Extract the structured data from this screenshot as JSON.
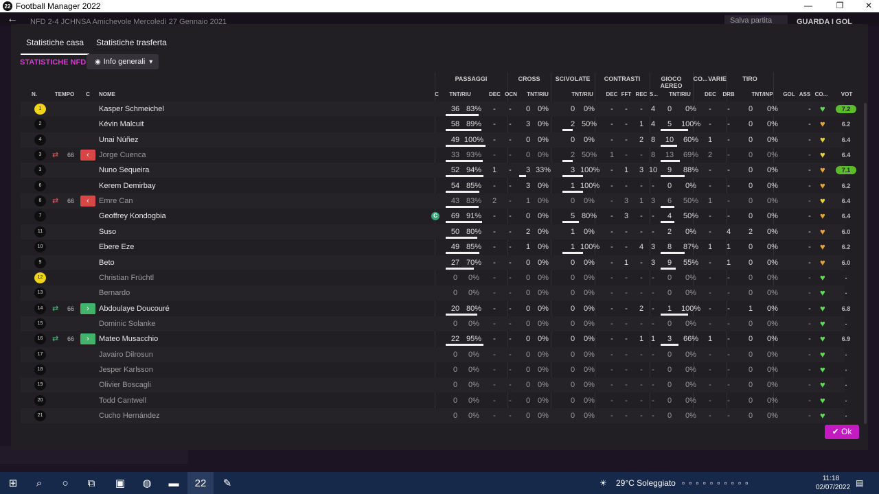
{
  "window": {
    "title": "Football Manager 2022",
    "app_icon": "22",
    "minimize": "—",
    "maximize": "❐",
    "close": "✕"
  },
  "appbar": {
    "match": "NFD 2-4 JCHNSA Amichevole Mercoledì 27 Gennaio 2021",
    "save_label": "Salva partita",
    "next_label": "GUARDA I GOL"
  },
  "tabs": [
    "Statistiche casa",
    "Statistiche trasferta"
  ],
  "section_title": "STATISTICHE NFD",
  "dropdown": "Info generali",
  "groups": {
    "passaggi": "PASSAGGI",
    "cross": "CROSS",
    "scivolate": "SCIVOLATE",
    "contrasti": "CONTRASTI",
    "gioco_aereo": "GIOCO AEREO",
    "co": "CO...",
    "varie": "VARIE",
    "tiro": "TIRO"
  },
  "headers": {
    "n": "N.",
    "tempo": "TEMPO",
    "c": "C",
    "nome": "NOME",
    "c2": "C",
    "pass": "TNT/RIU",
    "dec": "DEC",
    "ocn": "OCN",
    "cross": "TNT/RIU",
    "sciv": "TNT/RIU",
    "cdec": "DEC",
    "fft": "FFT",
    "rec": "REC",
    "s": "S...",
    "aereo": "TNT/RIU",
    "codec": "DEC",
    "drb": "DRB",
    "tiro": "TNT/INP",
    "gol": "GOL",
    "ass": "ASS",
    "co": "CO...",
    "vot": "VOT"
  },
  "players": [
    {
      "n": "1",
      "gk": true,
      "name": "Kasper Schmeichel",
      "dim": false,
      "sub": "",
      "min": "",
      "cap": false,
      "pt": "36",
      "pp": "83%",
      "pbar": 0.83,
      "dec": "-",
      "ocn": "-",
      "ct": "0",
      "cp": "0%",
      "cbar": 0,
      "st": "0",
      "sp": "0%",
      "sbar": 0,
      "kd": "-",
      "kf": "-",
      "kr": "-",
      "ks": "4",
      "at": "0",
      "ap": "0%",
      "abar": 0,
      "cod": "-",
      "drb": "-",
      "tt": "0",
      "tp": "0%",
      "gol": "",
      "ass": "-",
      "heart": "#5fdc55",
      "vot": "7.2",
      "badge": true
    },
    {
      "n": "2",
      "gk": false,
      "name": "Kévin Malcuit",
      "dim": false,
      "sub": "",
      "min": "",
      "cap": false,
      "pt": "58",
      "pp": "89%",
      "pbar": 0.89,
      "dec": "-",
      "ocn": "-",
      "ct": "3",
      "cp": "0%",
      "cbar": 0,
      "st": "2",
      "sp": "50%",
      "sbar": 0.5,
      "kd": "-",
      "kf": "-",
      "kr": "1",
      "ks": "4",
      "at": "5",
      "ap": "100%",
      "abar": 1,
      "cod": "-",
      "drb": "-",
      "tt": "0",
      "tp": "0%",
      "gol": "",
      "ass": "-",
      "heart": "#e8a23a",
      "vot": "6.2",
      "badge": false
    },
    {
      "n": "4",
      "gk": false,
      "name": "Unai Núñez",
      "dim": false,
      "sub": "",
      "min": "",
      "cap": false,
      "pt": "49",
      "pp": "100%",
      "pbar": 1,
      "dec": "-",
      "ocn": "-",
      "ct": "0",
      "cp": "0%",
      "cbar": 0,
      "st": "0",
      "sp": "0%",
      "sbar": 0,
      "kd": "-",
      "kf": "-",
      "kr": "2",
      "ks": "8",
      "at": "10",
      "ap": "60%",
      "abar": 0.6,
      "cod": "1",
      "drb": "-",
      "tt": "0",
      "tp": "0%",
      "gol": "",
      "ass": "-",
      "heart": "#e6d43a",
      "vot": "6.4",
      "badge": false
    },
    {
      "n": "3",
      "gk": false,
      "name": "Jorge Cuenca",
      "dim": true,
      "sub": "out",
      "min": "66",
      "cap": false,
      "pt": "33",
      "pp": "93%",
      "pbar": 0.93,
      "dec": "-",
      "ocn": "-",
      "ct": "0",
      "cp": "0%",
      "cbar": 0,
      "st": "2",
      "sp": "50%",
      "sbar": 0.5,
      "kd": "1",
      "kf": "-",
      "kr": "-",
      "ks": "8",
      "at": "13",
      "ap": "69%",
      "abar": 0.69,
      "cod": "2",
      "drb": "-",
      "tt": "0",
      "tp": "0%",
      "gol": "",
      "ass": "-",
      "heart": "#e6d43a",
      "vot": "6.4",
      "badge": false
    },
    {
      "n": "3",
      "gk": false,
      "name": "Nuno Sequeira",
      "dim": false,
      "sub": "",
      "min": "",
      "cap": false,
      "pt": "52",
      "pp": "94%",
      "pbar": 0.94,
      "dec": "1",
      "ocn": "-",
      "ct": "3",
      "cp": "33%",
      "cbar": 0.33,
      "st": "3",
      "sp": "100%",
      "sbar": 1,
      "kd": "-",
      "kf": "1",
      "kr": "3",
      "ks": "10",
      "at": "9",
      "ap": "88%",
      "abar": 0.88,
      "cod": "-",
      "drb": "-",
      "tt": "0",
      "tp": "0%",
      "gol": "",
      "ass": "-",
      "heart": "#e8a23a",
      "vot": "7.1",
      "badge": true
    },
    {
      "n": "6",
      "gk": false,
      "name": "Kerem Demirbay",
      "dim": false,
      "sub": "",
      "min": "",
      "cap": false,
      "pt": "54",
      "pp": "85%",
      "pbar": 0.85,
      "dec": "-",
      "ocn": "-",
      "ct": "3",
      "cp": "0%",
      "cbar": 0,
      "st": "1",
      "sp": "100%",
      "sbar": 1,
      "kd": "-",
      "kf": "-",
      "kr": "-",
      "ks": "-",
      "at": "0",
      "ap": "0%",
      "abar": 0,
      "cod": "-",
      "drb": "-",
      "tt": "0",
      "tp": "0%",
      "gol": "",
      "ass": "-",
      "heart": "#e8a23a",
      "vot": "6.2",
      "badge": false
    },
    {
      "n": "8",
      "gk": false,
      "name": "Emre Can",
      "dim": true,
      "sub": "out",
      "min": "66",
      "cap": false,
      "pt": "43",
      "pp": "83%",
      "pbar": 0.83,
      "dec": "2",
      "ocn": "-",
      "ct": "1",
      "cp": "0%",
      "cbar": 0,
      "st": "0",
      "sp": "0%",
      "sbar": 0,
      "kd": "-",
      "kf": "3",
      "kr": "1",
      "ks": "3",
      "at": "6",
      "ap": "50%",
      "abar": 0.5,
      "cod": "1",
      "drb": "-",
      "tt": "0",
      "tp": "0%",
      "gol": "",
      "ass": "-",
      "heart": "#e6d43a",
      "vot": "6.4",
      "badge": false
    },
    {
      "n": "7",
      "gk": false,
      "name": "Geoffrey Kondogbia",
      "dim": false,
      "sub": "",
      "min": "",
      "cap": true,
      "pt": "69",
      "pp": "91%",
      "pbar": 0.91,
      "dec": "-",
      "ocn": "-",
      "ct": "0",
      "cp": "0%",
      "cbar": 0,
      "st": "5",
      "sp": "80%",
      "sbar": 0.8,
      "kd": "-",
      "kf": "3",
      "kr": "-",
      "ks": "-",
      "at": "4",
      "ap": "50%",
      "abar": 0.5,
      "cod": "-",
      "drb": "-",
      "tt": "0",
      "tp": "0%",
      "gol": "",
      "ass": "-",
      "heart": "#e8a23a",
      "vot": "6.4",
      "badge": false
    },
    {
      "n": "11",
      "gk": false,
      "name": "Suso",
      "dim": false,
      "sub": "",
      "min": "",
      "cap": false,
      "pt": "50",
      "pp": "80%",
      "pbar": 0.8,
      "dec": "-",
      "ocn": "-",
      "ct": "2",
      "cp": "0%",
      "cbar": 0,
      "st": "1",
      "sp": "0%",
      "sbar": 0,
      "kd": "-",
      "kf": "-",
      "kr": "-",
      "ks": "-",
      "at": "2",
      "ap": "0%",
      "abar": 0,
      "cod": "-",
      "drb": "4",
      "tt": "2",
      "tp": "0%",
      "gol": "",
      "ass": "-",
      "heart": "#e8a23a",
      "vot": "6.0",
      "badge": false
    },
    {
      "n": "10",
      "gk": false,
      "name": "Ebere Eze",
      "dim": false,
      "sub": "",
      "min": "",
      "cap": false,
      "pt": "49",
      "pp": "85%",
      "pbar": 0.85,
      "dec": "-",
      "ocn": "-",
      "ct": "1",
      "cp": "0%",
      "cbar": 0,
      "st": "1",
      "sp": "100%",
      "sbar": 1,
      "kd": "-",
      "kf": "-",
      "kr": "4",
      "ks": "3",
      "at": "8",
      "ap": "87%",
      "abar": 0.87,
      "cod": "1",
      "drb": "1",
      "tt": "0",
      "tp": "0%",
      "gol": "",
      "ass": "-",
      "heart": "#e8a23a",
      "vot": "6.2",
      "badge": false
    },
    {
      "n": "9",
      "gk": false,
      "name": "Beto",
      "dim": false,
      "sub": "",
      "min": "",
      "cap": false,
      "pt": "27",
      "pp": "70%",
      "pbar": 0.7,
      "dec": "-",
      "ocn": "-",
      "ct": "0",
      "cp": "0%",
      "cbar": 0,
      "st": "0",
      "sp": "0%",
      "sbar": 0,
      "kd": "-",
      "kf": "1",
      "kr": "-",
      "ks": "3",
      "at": "9",
      "ap": "55%",
      "abar": 0.55,
      "cod": "-",
      "drb": "1",
      "tt": "0",
      "tp": "0%",
      "gol": "",
      "ass": "-",
      "heart": "#e8a23a",
      "vot": "6.0",
      "badge": false
    },
    {
      "n": "12",
      "gk": true,
      "name": "Christian Früchtl",
      "dim": true,
      "sub": "",
      "min": "",
      "cap": false,
      "pt": "0",
      "pp": "0%",
      "pbar": 0,
      "dec": "-",
      "ocn": "-",
      "ct": "0",
      "cp": "0%",
      "cbar": 0,
      "st": "0",
      "sp": "0%",
      "sbar": 0,
      "kd": "-",
      "kf": "-",
      "kr": "-",
      "ks": "-",
      "at": "0",
      "ap": "0%",
      "abar": 0,
      "cod": "-",
      "drb": "-",
      "tt": "0",
      "tp": "0%",
      "gol": "",
      "ass": "-",
      "heart": "#5fdc55",
      "vot": "-",
      "badge": false
    },
    {
      "n": "13",
      "gk": false,
      "name": "Bernardo",
      "dim": true,
      "sub": "",
      "min": "",
      "cap": false,
      "pt": "0",
      "pp": "0%",
      "pbar": 0,
      "dec": "-",
      "ocn": "-",
      "ct": "0",
      "cp": "0%",
      "cbar": 0,
      "st": "0",
      "sp": "0%",
      "sbar": 0,
      "kd": "-",
      "kf": "-",
      "kr": "-",
      "ks": "-",
      "at": "0",
      "ap": "0%",
      "abar": 0,
      "cod": "-",
      "drb": "-",
      "tt": "0",
      "tp": "0%",
      "gol": "",
      "ass": "-",
      "heart": "#5fdc55",
      "vot": "-",
      "badge": false
    },
    {
      "n": "14",
      "gk": false,
      "name": "Abdoulaye Doucouré",
      "dim": false,
      "sub": "in",
      "min": "66",
      "cap": false,
      "pt": "20",
      "pp": "80%",
      "pbar": 0.8,
      "dec": "-",
      "ocn": "-",
      "ct": "0",
      "cp": "0%",
      "cbar": 0,
      "st": "0",
      "sp": "0%",
      "sbar": 0,
      "kd": "-",
      "kf": "-",
      "kr": "2",
      "ks": "-",
      "at": "1",
      "ap": "100%",
      "abar": 1,
      "cod": "-",
      "drb": "-",
      "tt": "1",
      "tp": "0%",
      "gol": "",
      "ass": "-",
      "heart": "#5fdc55",
      "vot": "6.8",
      "badge": false
    },
    {
      "n": "15",
      "gk": false,
      "name": "Dominic Solanke",
      "dim": true,
      "sub": "",
      "min": "",
      "cap": false,
      "pt": "0",
      "pp": "0%",
      "pbar": 0,
      "dec": "-",
      "ocn": "-",
      "ct": "0",
      "cp": "0%",
      "cbar": 0,
      "st": "0",
      "sp": "0%",
      "sbar": 0,
      "kd": "-",
      "kf": "-",
      "kr": "-",
      "ks": "-",
      "at": "0",
      "ap": "0%",
      "abar": 0,
      "cod": "-",
      "drb": "-",
      "tt": "0",
      "tp": "0%",
      "gol": "",
      "ass": "-",
      "heart": "#5fdc55",
      "vot": "-",
      "badge": false
    },
    {
      "n": "16",
      "gk": false,
      "name": "Mateo Musacchio",
      "dim": false,
      "sub": "in",
      "min": "66",
      "cap": false,
      "pt": "22",
      "pp": "95%",
      "pbar": 0.95,
      "dec": "-",
      "ocn": "-",
      "ct": "0",
      "cp": "0%",
      "cbar": 0,
      "st": "0",
      "sp": "0%",
      "sbar": 0,
      "kd": "-",
      "kf": "-",
      "kr": "1",
      "ks": "1",
      "at": "3",
      "ap": "66%",
      "abar": 0.66,
      "cod": "1",
      "drb": "-",
      "tt": "0",
      "tp": "0%",
      "gol": "",
      "ass": "-",
      "heart": "#5fdc55",
      "vot": "6.9",
      "badge": false
    },
    {
      "n": "17",
      "gk": false,
      "name": "Javairo Dilrosun",
      "dim": true,
      "sub": "",
      "min": "",
      "cap": false,
      "pt": "0",
      "pp": "0%",
      "pbar": 0,
      "dec": "-",
      "ocn": "-",
      "ct": "0",
      "cp": "0%",
      "cbar": 0,
      "st": "0",
      "sp": "0%",
      "sbar": 0,
      "kd": "-",
      "kf": "-",
      "kr": "-",
      "ks": "-",
      "at": "0",
      "ap": "0%",
      "abar": 0,
      "cod": "-",
      "drb": "-",
      "tt": "0",
      "tp": "0%",
      "gol": "",
      "ass": "-",
      "heart": "#5fdc55",
      "vot": "-",
      "badge": false
    },
    {
      "n": "18",
      "gk": false,
      "name": "Jesper Karlsson",
      "dim": true,
      "sub": "",
      "min": "",
      "cap": false,
      "pt": "0",
      "pp": "0%",
      "pbar": 0,
      "dec": "-",
      "ocn": "-",
      "ct": "0",
      "cp": "0%",
      "cbar": 0,
      "st": "0",
      "sp": "0%",
      "sbar": 0,
      "kd": "-",
      "kf": "-",
      "kr": "-",
      "ks": "-",
      "at": "0",
      "ap": "0%",
      "abar": 0,
      "cod": "-",
      "drb": "-",
      "tt": "0",
      "tp": "0%",
      "gol": "",
      "ass": "-",
      "heart": "#5fdc55",
      "vot": "-",
      "badge": false
    },
    {
      "n": "19",
      "gk": false,
      "name": "Olivier Boscagli",
      "dim": true,
      "sub": "",
      "min": "",
      "cap": false,
      "pt": "0",
      "pp": "0%",
      "pbar": 0,
      "dec": "-",
      "ocn": "-",
      "ct": "0",
      "cp": "0%",
      "cbar": 0,
      "st": "0",
      "sp": "0%",
      "sbar": 0,
      "kd": "-",
      "kf": "-",
      "kr": "-",
      "ks": "-",
      "at": "0",
      "ap": "0%",
      "abar": 0,
      "cod": "-",
      "drb": "-",
      "tt": "0",
      "tp": "0%",
      "gol": "",
      "ass": "-",
      "heart": "#5fdc55",
      "vot": "-",
      "badge": false
    },
    {
      "n": "20",
      "gk": false,
      "name": "Todd Cantwell",
      "dim": true,
      "sub": "",
      "min": "",
      "cap": false,
      "pt": "0",
      "pp": "0%",
      "pbar": 0,
      "dec": "-",
      "ocn": "-",
      "ct": "0",
      "cp": "0%",
      "cbar": 0,
      "st": "0",
      "sp": "0%",
      "sbar": 0,
      "kd": "-",
      "kf": "-",
      "kr": "-",
      "ks": "-",
      "at": "0",
      "ap": "0%",
      "abar": 0,
      "cod": "-",
      "drb": "-",
      "tt": "0",
      "tp": "0%",
      "gol": "",
      "ass": "-",
      "heart": "#5fdc55",
      "vot": "-",
      "badge": false
    },
    {
      "n": "21",
      "gk": false,
      "name": "Cucho Hernández",
      "dim": true,
      "sub": "",
      "min": "",
      "cap": false,
      "pt": "0",
      "pp": "0%",
      "pbar": 0,
      "dec": "-",
      "ocn": "-",
      "ct": "0",
      "cp": "0%",
      "cbar": 0,
      "st": "0",
      "sp": "0%",
      "sbar": 0,
      "kd": "-",
      "kf": "-",
      "kr": "-",
      "ks": "-",
      "at": "0",
      "ap": "0%",
      "abar": 0,
      "cod": "-",
      "drb": "-",
      "tt": "0",
      "tp": "0%",
      "gol": "",
      "ass": "-",
      "heart": "#5fdc55",
      "vot": "-",
      "badge": false
    }
  ],
  "ok_label": "Ok",
  "ok_icon": "check-icon",
  "captain_glyph": "C",
  "taskbar": {
    "weather": "29°C Soleggiato",
    "time": "11:18",
    "date": "02/07/2022",
    "fm_label": "22"
  }
}
